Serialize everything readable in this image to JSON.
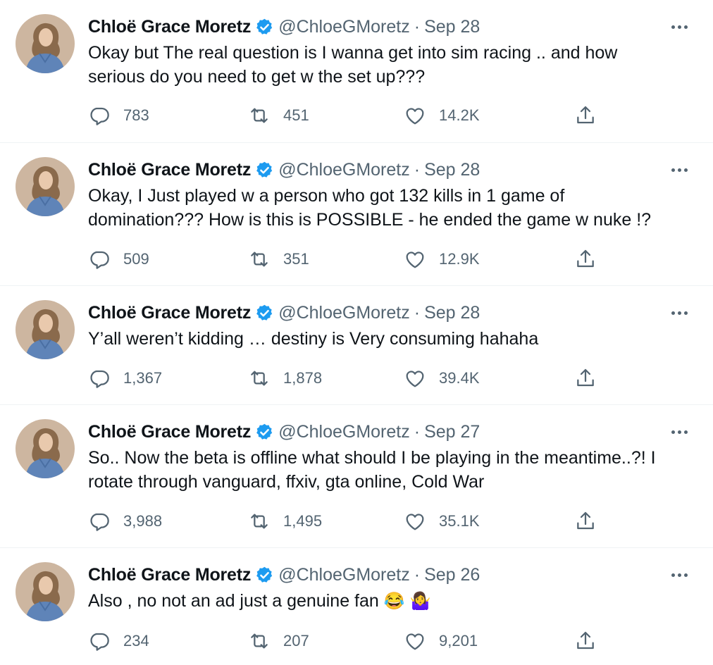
{
  "user": {
    "name": "Chloë Grace Moretz",
    "handle": "@ChloeGMoretz",
    "separator": "·"
  },
  "colors": {
    "verified": "#1d9bf0",
    "text": "#0f1419",
    "muted": "#536471",
    "divider": "#eff3f4"
  },
  "tweets": [
    {
      "date": "Sep 28",
      "text": "Okay but The real question is I wanna get into sim racing .. and how\nserious do you need to get w the set up???",
      "replies": "783",
      "retweets": "451",
      "likes": "14.2K"
    },
    {
      "date": "Sep 28",
      "text": "Okay, I Just played w a person who got 132 kills in 1 game of\ndomination??? How is this is POSSIBLE - he ended the game w nuke !?",
      "replies": "509",
      "retweets": "351",
      "likes": "12.9K"
    },
    {
      "date": "Sep 28",
      "text": "Y’all weren’t kidding … destiny is Very consuming hahaha",
      "replies": "1,367",
      "retweets": "1,878",
      "likes": "39.4K"
    },
    {
      "date": "Sep 27",
      "text": "So.. Now the beta is offline what should I be playing in the meantime..?! I\nrotate through vanguard, ffxiv, gta online, Cold War",
      "replies": "3,988",
      "retweets": "1,495",
      "likes": "35.1K"
    },
    {
      "date": "Sep 26",
      "text": "Also , no not an ad just a genuine fan ",
      "emojis": [
        "😂",
        "🤷‍♀️"
      ],
      "replies": "234",
      "retweets": "207",
      "likes": "9,201"
    }
  ],
  "icons": {
    "verified": "verified-badge-icon",
    "more": "more-options-icon",
    "reply": "reply-icon",
    "retweet": "retweet-icon",
    "like": "heart-icon",
    "share": "share-icon"
  }
}
